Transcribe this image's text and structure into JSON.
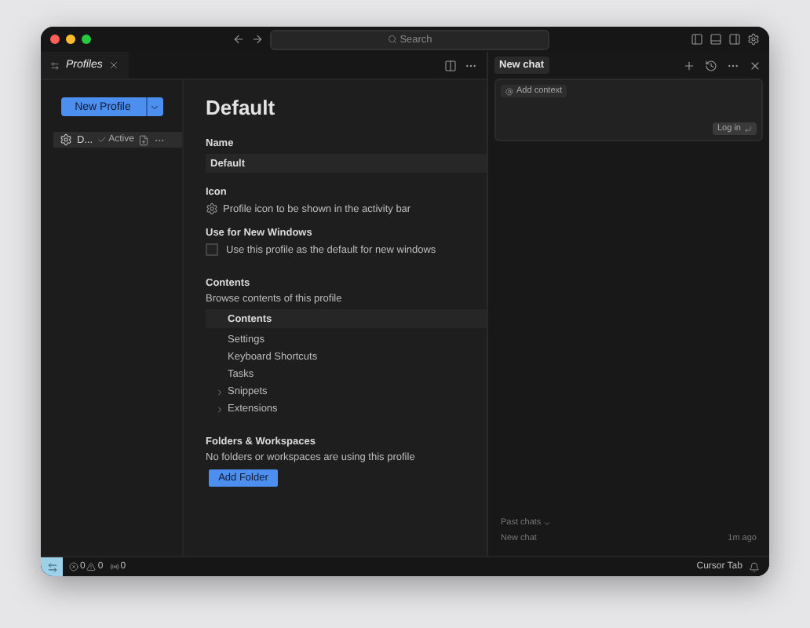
{
  "titlebar": {
    "search": "Search"
  },
  "editor_tab": {
    "label": "Profiles",
    "selected": true
  },
  "sidebar": {
    "new_profile_button": "New Profile",
    "profiles": [
      {
        "label": "D...",
        "status": "Active",
        "selected": true
      }
    ]
  },
  "profile": {
    "title": "Default",
    "name_label": "Name",
    "name_value": "Default",
    "icon_label": "Icon",
    "icon_description": "Profile icon to be shown in the activity bar",
    "new_windows_label": "Use for New Windows",
    "new_windows_checkbox": {
      "label": "Use this profile as the default for new windows",
      "checked": false
    },
    "contents": {
      "heading": "Contents",
      "description": "Browse contents of this profile",
      "tree_header": "Contents",
      "items": [
        {
          "label": "Settings",
          "expandable": false
        },
        {
          "label": "Keyboard Shortcuts",
          "expandable": false
        },
        {
          "label": "Tasks",
          "expandable": false
        },
        {
          "label": "Snippets",
          "expandable": true
        },
        {
          "label": "Extensions",
          "expandable": true
        }
      ]
    },
    "folders": {
      "heading": "Folders & Workspaces",
      "description": "No folders or workspaces are using this profile",
      "button": "Add Folder"
    }
  },
  "chat": {
    "tab": "New chat",
    "add_context": "Add context",
    "login": "Log in",
    "past_chats": "Past chats",
    "history": [
      {
        "title": "New chat",
        "time": "1m ago"
      }
    ]
  },
  "status_bar": {
    "errors": "0",
    "warnings": "0",
    "ports": "0",
    "cursor_tab": "Cursor Tab"
  }
}
